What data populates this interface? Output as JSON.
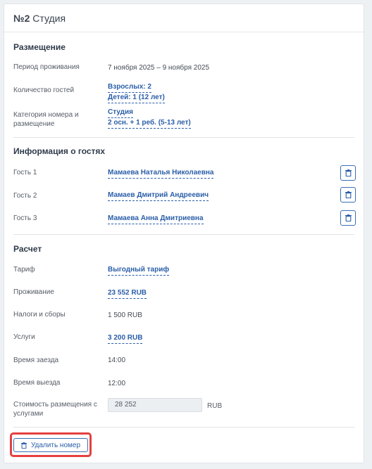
{
  "room": {
    "number": "№2",
    "name": "Студия"
  },
  "placement": {
    "title": "Размещение",
    "period_label": "Период проживания",
    "period_value": "7 ноября 2025 – 9 ноября 2025",
    "guests_label": "Количество гостей",
    "adults": "Взрослых: 2",
    "children": "Детей: 1 (12 лет)",
    "category_label": "Категория номера и размещение",
    "category_value": "Студия",
    "category_detail": "2 осн. + 1 реб. (5-13 лет)"
  },
  "guests": {
    "title": "Информация о гостях",
    "items": [
      {
        "label": "Гость 1",
        "name": "Мамаева Наталья Николаевна"
      },
      {
        "label": "Гость 2",
        "name": "Мамаев Дмитрий Андреевич"
      },
      {
        "label": "Гость 3",
        "name": "Мамаева Анна Дмитриевна"
      }
    ]
  },
  "calculation": {
    "title": "Расчет",
    "tariff_label": "Тариф",
    "tariff_value": "Выгодный тариф",
    "stay_label": "Проживание",
    "stay_value": "23 552 RUB",
    "taxes_label": "Налоги и сборы",
    "taxes_value": "1 500 RUB",
    "services_label": "Услуги",
    "services_value": "3 200 RUB",
    "checkin_label": "Время заезда",
    "checkin_value": "14:00",
    "checkout_label": "Время выезда",
    "checkout_value": "12:00",
    "total_label": "Стоимость размещения с услугами",
    "total_value": "28 252",
    "total_unit": "RUB"
  },
  "actions": {
    "delete_room": "Удалить номер"
  },
  "icons": {
    "trash": "trash-icon"
  },
  "colors": {
    "accent": "#2a5ea8",
    "highlight": "#e5403f"
  }
}
